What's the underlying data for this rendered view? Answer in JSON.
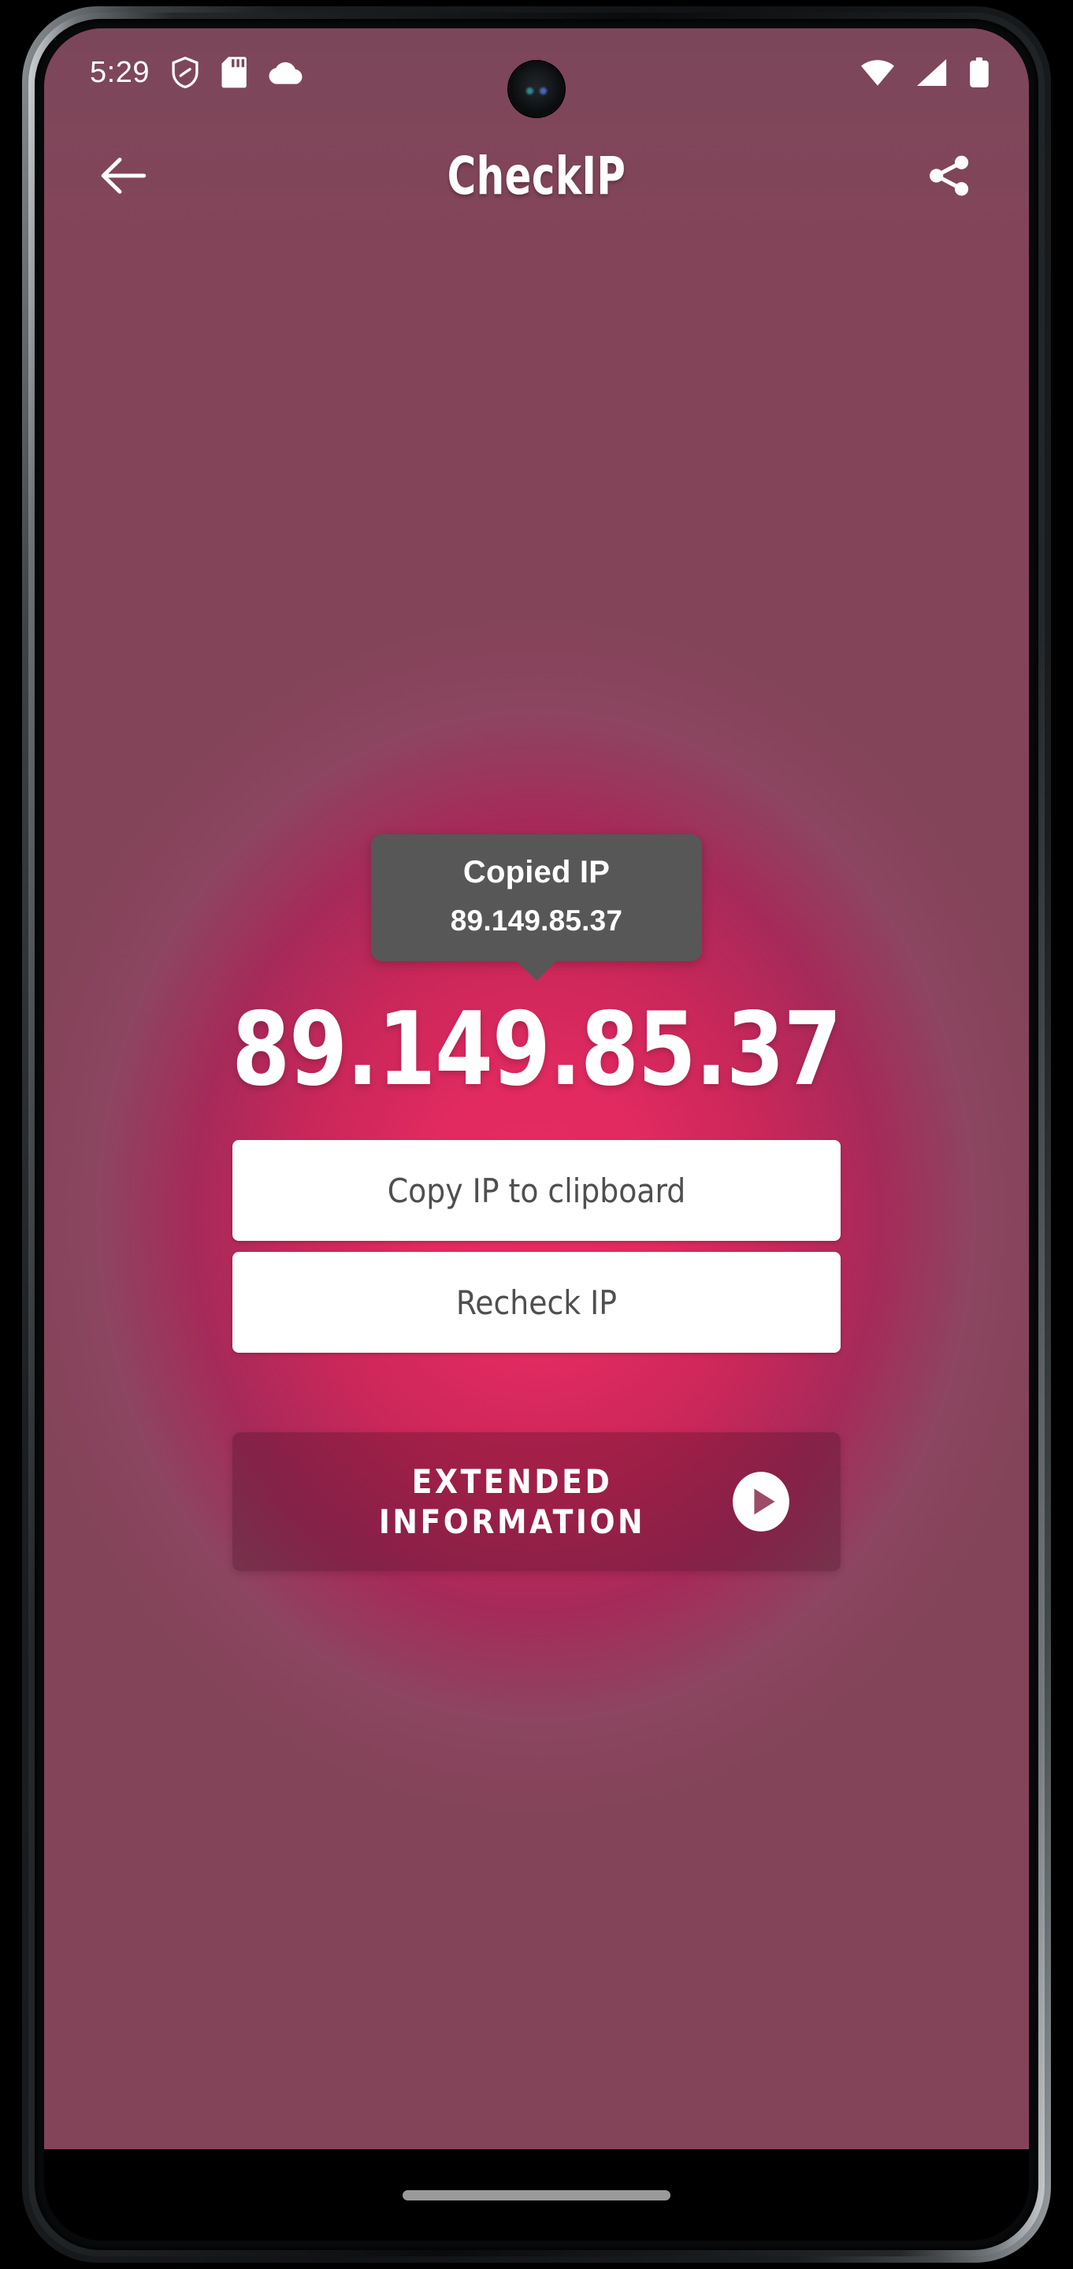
{
  "device": {
    "nav_pill": "home-gesture-pill"
  },
  "status_bar": {
    "clock": "5:29",
    "left_icons": [
      "shield-icon",
      "sd-card-icon",
      "cloud-icon"
    ],
    "right_icons": [
      "wifi-icon",
      "cellular-signal-icon",
      "battery-icon"
    ]
  },
  "app_bar": {
    "title": "CheckIP",
    "back_icon": "arrow-left-icon",
    "share_icon": "share-icon"
  },
  "toast": {
    "title": "Copied IP",
    "value": "89.149.85.37"
  },
  "main": {
    "ip_address": "89.149.85.37",
    "copy_button_label": "Copy IP to clipboard",
    "recheck_button_label": "Recheck IP",
    "extended_button_label": "EXTENDED INFORMATION",
    "extended_button_icon": "play-circle-icon"
  },
  "colors": {
    "accent_pink": "#e22a60",
    "muted_mauve": "#8d4560",
    "toast_gray": "#575757",
    "button_white": "#ffffff",
    "button_text_gray": "#4f4f4f",
    "status_bar_overlay": "#76485a"
  }
}
